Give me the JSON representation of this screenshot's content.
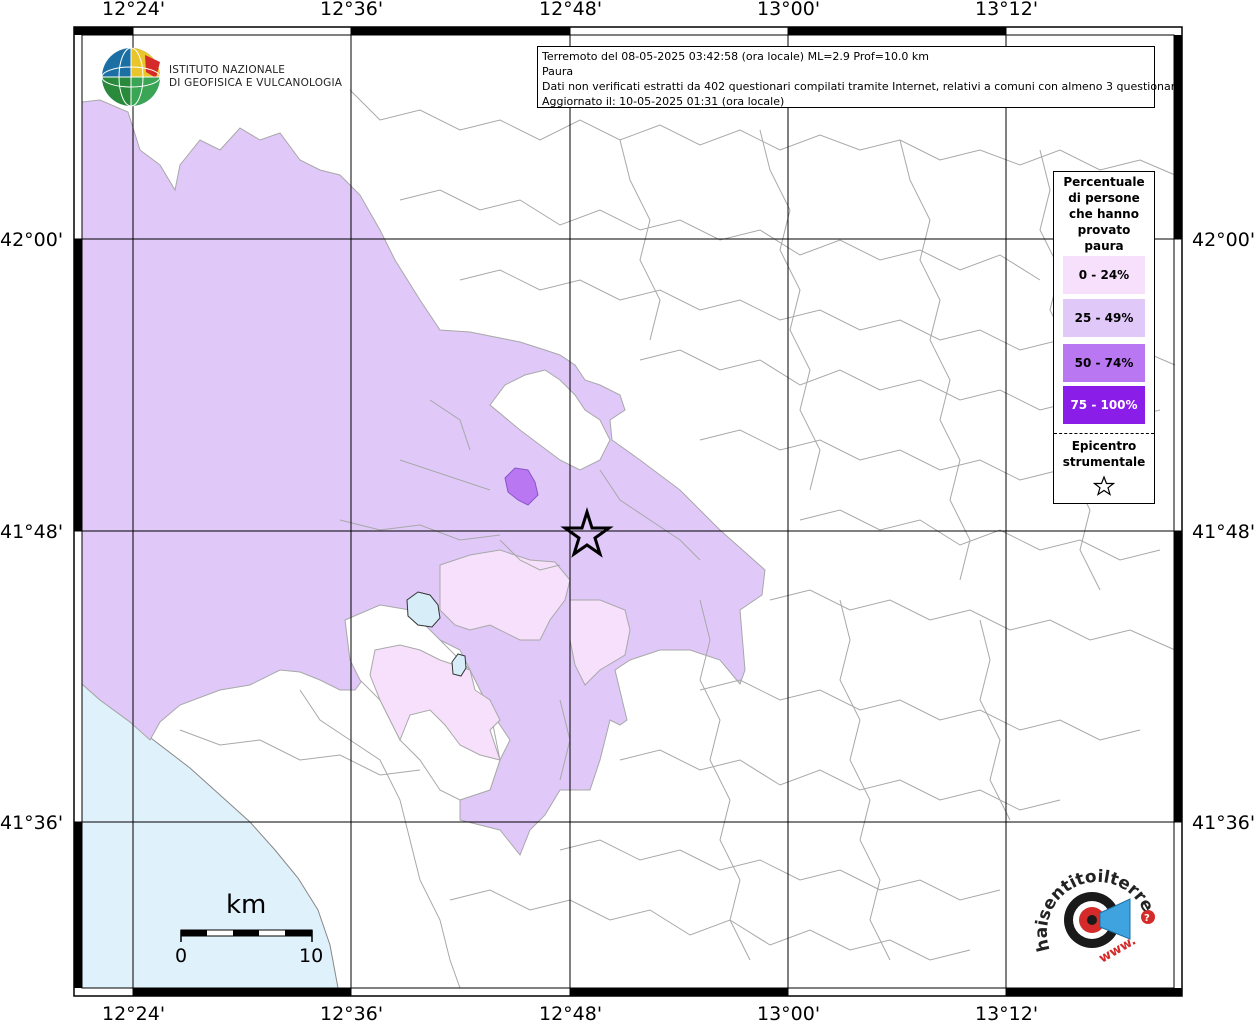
{
  "header": {
    "line1": "Terremoto del 08-05-2025 03:42:58 (ora locale) ML=2.9 Prof=10.0 km",
    "line2": "Paura",
    "line3": "Dati non verificati estratti da 402 questionari compilati tramite Internet, relativi a comuni con almeno 3 questionari.",
    "line4": "Aggiornato il: 10-05-2025 01:31 (ora locale)"
  },
  "logo": {
    "line1": "ISTITUTO NAZIONALE",
    "line2": "DI GEOFISICA E VULCANOLOGIA"
  },
  "axes": {
    "top": [
      "12°24'",
      "12°36'",
      "12°48'",
      "13°00'",
      "13°12'"
    ],
    "bottom": [
      "12°24'",
      "12°36'",
      "12°48'",
      "13°00'",
      "13°12'"
    ],
    "left": [
      "42°00'",
      "41°48'",
      "41°36'"
    ],
    "right": [
      "42°00'",
      "41°48'",
      "41°36'"
    ]
  },
  "legend": {
    "title_lines": [
      "Percentuale",
      "di persone",
      "che hanno",
      "provato",
      "paura"
    ],
    "classes": [
      {
        "label": "0 - 24%",
        "color": "#f7e0fb",
        "text_color": "#000000"
      },
      {
        "label": "25 - 49%",
        "color": "#e0c8f9",
        "text_color": "#000000"
      },
      {
        "label": "50 - 74%",
        "color": "#b978f1",
        "text_color": "#000000"
      },
      {
        "label": "75 - 100%",
        "color": "#8a1ee8",
        "text_color": "#ffffff"
      }
    ],
    "epicenter_lines": [
      "Epicentro",
      "strumentale"
    ],
    "epicenter_icon": "star-icon"
  },
  "scale": {
    "unit": "km",
    "min": "0",
    "max": "10"
  },
  "colors": {
    "sea": "#dff1fb",
    "lake": "#d7eef8",
    "boundary": "#a8a8a8"
  },
  "badge": {
    "text_arc": "haisentitoilterremoto.it",
    "www": "www.",
    "icon": "megaphone-icon"
  }
}
